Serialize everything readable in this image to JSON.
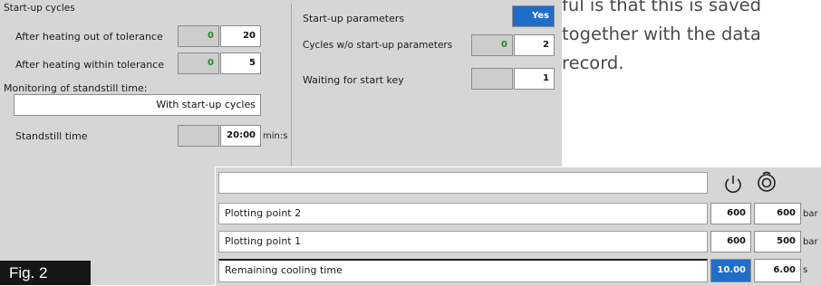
{
  "startup_cycles": {
    "title": "Start-up cycles",
    "rows": [
      {
        "label": "After heating out of tolerance",
        "actual": "0",
        "set": "20"
      },
      {
        "label": "After heating within tolerance",
        "actual": "0",
        "set": "5"
      }
    ]
  },
  "monitoring": {
    "title": "Monitoring of standstill time:",
    "mode": "With start-up cycles",
    "standstill_label": "Standstill time",
    "standstill_actual": "",
    "standstill_value": "20:00",
    "standstill_unit": "min:s"
  },
  "startup_parameters": {
    "title": "Start-up parameters",
    "toggle": "Yes",
    "cycles_label": "Cycles w/o start-up parameters",
    "cycles_actual": "0",
    "cycles_set": "2",
    "wait_label": "Waiting for start key",
    "wait_actual": "",
    "wait_set": "1"
  },
  "paragraph": {
    "lines": [
      "ful is that this is saved",
      "together with the data",
      "record."
    ]
  },
  "figure_label": "Fig. 2",
  "points_table": {
    "icons": [
      "power-icon",
      "nozzle-icon"
    ],
    "rows": [
      {
        "label": "Plotting point 2",
        "v1": "600",
        "v2": "600",
        "unit": "bar"
      },
      {
        "label": "Plotting point 1",
        "v1": "600",
        "v2": "500",
        "unit": "bar"
      },
      {
        "label": "Remaining cooling time",
        "v1": "10.00",
        "v2": "6.00",
        "unit": "s"
      }
    ]
  },
  "colors": {
    "accent": "#1e6ec8",
    "panel": "#d6d6d6",
    "actual_value": "#2a8a2a"
  }
}
